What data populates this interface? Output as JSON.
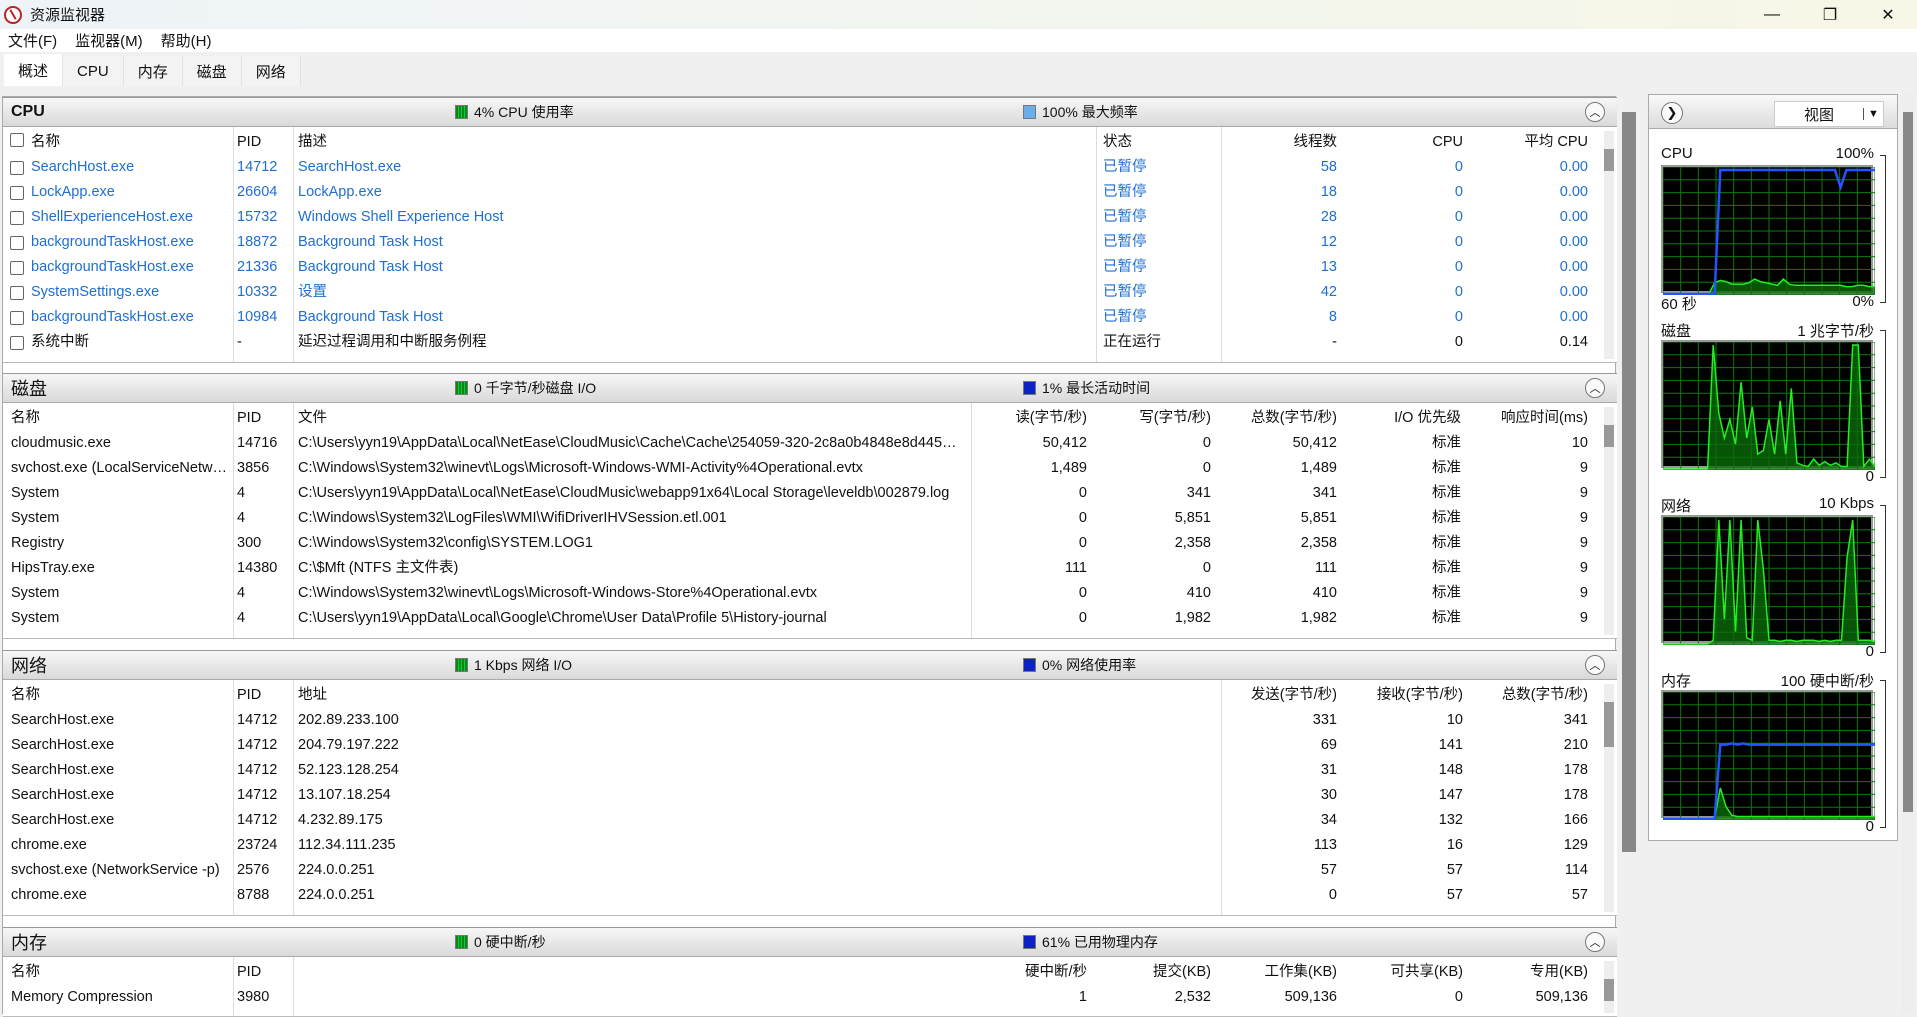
{
  "window": {
    "title": "资源监视器",
    "minimize": "—",
    "maximize": "❐",
    "close": "✕"
  },
  "menu": [
    "文件(F)",
    "监视器(M)",
    "帮助(H)"
  ],
  "tabs": [
    "概述",
    "CPU",
    "内存",
    "磁盘",
    "网络"
  ],
  "colors": {
    "link": "#1e6fd0",
    "graph_bg": "#000000",
    "graph_grid": "#0a7a0a",
    "graph_line": "#22ee22",
    "graph_max": "#2255ff"
  },
  "cpu": {
    "title": "CPU",
    "ind1": "4% CPU 使用率",
    "ind2": "100% 最大频率",
    "headers": [
      "名称",
      "PID",
      "描述",
      "状态",
      "线程数",
      "CPU",
      "平均 CPU"
    ],
    "rows": [
      [
        "SearchHost.exe",
        "14712",
        "SearchHost.exe",
        "已暂停",
        "58",
        "0",
        "0.00"
      ],
      [
        "LockApp.exe",
        "26604",
        "LockApp.exe",
        "已暂停",
        "18",
        "0",
        "0.00"
      ],
      [
        "ShellExperienceHost.exe",
        "15732",
        "Windows Shell Experience Host",
        "已暂停",
        "28",
        "0",
        "0.00"
      ],
      [
        "backgroundTaskHost.exe",
        "18872",
        "Background Task Host",
        "已暂停",
        "12",
        "0",
        "0.00"
      ],
      [
        "backgroundTaskHost.exe",
        "21336",
        "Background Task Host",
        "已暂停",
        "13",
        "0",
        "0.00"
      ],
      [
        "SystemSettings.exe",
        "10332",
        "设置",
        "已暂停",
        "42",
        "0",
        "0.00"
      ],
      [
        "backgroundTaskHost.exe",
        "10984",
        "Background Task Host",
        "已暂停",
        "8",
        "0",
        "0.00"
      ],
      [
        "系统中断",
        "-",
        "延迟过程调用和中断服务例程",
        "正在运行",
        "-",
        "0",
        "0.14"
      ]
    ]
  },
  "disk": {
    "title": "磁盘",
    "ind1": "0 千字节/秒磁盘 I/O",
    "ind2": "1% 最长活动时间",
    "headers": [
      "名称",
      "PID",
      "文件",
      "读(字节/秒)",
      "写(字节/秒)",
      "总数(字节/秒)",
      "I/O 优先级",
      "响应时间(ms)"
    ],
    "rows": [
      [
        "cloudmusic.exe",
        "14716",
        "C:\\Users\\yyn19\\AppData\\Local\\NetEase\\CloudMusic\\Cache\\Cache\\254059-320-2c8a0b4848e8d445401...",
        "50,412",
        "0",
        "50,412",
        "标准",
        "10"
      ],
      [
        "svchost.exe (LocalServiceNetwo...",
        "3856",
        "C:\\Windows\\System32\\winevt\\Logs\\Microsoft-Windows-WMI-Activity%4Operational.evtx",
        "1,489",
        "0",
        "1,489",
        "标准",
        "9"
      ],
      [
        "System",
        "4",
        "C:\\Users\\yyn19\\AppData\\Local\\NetEase\\CloudMusic\\webapp91x64\\Local Storage\\leveldb\\002879.log",
        "0",
        "341",
        "341",
        "标准",
        "9"
      ],
      [
        "System",
        "4",
        "C:\\Windows\\System32\\LogFiles\\WMI\\WifiDriverIHVSession.etl.001",
        "0",
        "5,851",
        "5,851",
        "标准",
        "9"
      ],
      [
        "Registry",
        "300",
        "C:\\Windows\\System32\\config\\SYSTEM.LOG1",
        "0",
        "2,358",
        "2,358",
        "标准",
        "9"
      ],
      [
        "HipsTray.exe",
        "14380",
        "C:\\$Mft (NTFS 主文件表)",
        "111",
        "0",
        "111",
        "标准",
        "9"
      ],
      [
        "System",
        "4",
        "C:\\Windows\\System32\\winevt\\Logs\\Microsoft-Windows-Store%4Operational.evtx",
        "0",
        "410",
        "410",
        "标准",
        "9"
      ],
      [
        "System",
        "4",
        "C:\\Users\\yyn19\\AppData\\Local\\Google\\Chrome\\User Data\\Profile 5\\History-journal",
        "0",
        "1,982",
        "1,982",
        "标准",
        "9"
      ]
    ]
  },
  "network": {
    "title": "网络",
    "ind1": "1 Kbps 网络 I/O",
    "ind2": "0% 网络使用率",
    "headers": [
      "名称",
      "PID",
      "地址",
      "发送(字节/秒)",
      "接收(字节/秒)",
      "总数(字节/秒)"
    ],
    "rows": [
      [
        "SearchHost.exe",
        "14712",
        "202.89.233.100",
        "331",
        "10",
        "341"
      ],
      [
        "SearchHost.exe",
        "14712",
        "204.79.197.222",
        "69",
        "141",
        "210"
      ],
      [
        "SearchHost.exe",
        "14712",
        "52.123.128.254",
        "31",
        "148",
        "178"
      ],
      [
        "SearchHost.exe",
        "14712",
        "13.107.18.254",
        "30",
        "147",
        "178"
      ],
      [
        "SearchHost.exe",
        "14712",
        "4.232.89.175",
        "34",
        "132",
        "166"
      ],
      [
        "chrome.exe",
        "23724",
        "112.34.111.235",
        "113",
        "16",
        "129"
      ],
      [
        "svchost.exe (NetworkService -p)",
        "2576",
        "224.0.0.251",
        "57",
        "57",
        "114"
      ],
      [
        "chrome.exe",
        "8788",
        "224.0.0.251",
        "0",
        "57",
        "57"
      ]
    ]
  },
  "memory": {
    "title": "内存",
    "ind1": "0 硬中断/秒",
    "ind2": "61% 已用物理内存",
    "headers": [
      "名称",
      "PID",
      "硬中断/秒",
      "提交(KB)",
      "工作集(KB)",
      "可共享(KB)",
      "专用(KB)"
    ],
    "rows": [
      [
        "Memory Compression",
        "3980",
        "1",
        "2,532",
        "509,136",
        "0",
        "509,136"
      ]
    ]
  },
  "sidepanel": {
    "view_label": "视图",
    "graphs": [
      {
        "name": "CPU",
        "max": "100%",
        "time": "60 秒",
        "min": "0%",
        "line": [
          0,
          0,
          0,
          0,
          0,
          0,
          0,
          0,
          0,
          9,
          11,
          10,
          8,
          8,
          8,
          9,
          12,
          10,
          9,
          8,
          7,
          12,
          8,
          7,
          7,
          7,
          7,
          7,
          7,
          7,
          7,
          7,
          6,
          6,
          7,
          7,
          6,
          6
        ],
        "max_line": [
          0,
          0,
          0,
          0,
          0,
          0,
          0,
          0,
          0,
          0,
          100,
          100,
          100,
          100,
          100,
          100,
          100,
          100,
          100,
          100,
          100,
          100,
          100,
          100,
          100,
          100,
          100,
          100,
          100,
          100,
          100,
          86,
          100,
          100,
          100,
          100,
          100,
          100
        ]
      },
      {
        "name": "磁盘",
        "max": "1 兆字节/秒",
        "min": "0",
        "line": [
          0,
          0,
          0,
          0,
          0,
          0,
          0,
          0,
          0,
          100,
          45,
          25,
          40,
          20,
          70,
          25,
          50,
          12,
          15,
          40,
          12,
          55,
          12,
          65,
          5,
          3,
          2,
          8,
          3,
          6,
          3,
          5,
          2,
          2,
          100,
          100,
          2,
          8,
          2
        ]
      },
      {
        "name": "网络",
        "max": "10 Kbps",
        "min": "0",
        "line": [
          0,
          0,
          0,
          0,
          0,
          0,
          0,
          0,
          0,
          3,
          100,
          20,
          100,
          10,
          100,
          5,
          3,
          100,
          60,
          3,
          3,
          2,
          3,
          3,
          2,
          3,
          3,
          3,
          2,
          3,
          2,
          3,
          3,
          70,
          100,
          3,
          3,
          3,
          2
        ]
      },
      {
        "name": "内存",
        "max": "100 硬中断/秒",
        "min": "0",
        "line": [
          0,
          0,
          0,
          0,
          0,
          0,
          0,
          0,
          0,
          0,
          25,
          10,
          3,
          2,
          2,
          2,
          2,
          2,
          2,
          2,
          2,
          2,
          2,
          2,
          2,
          2,
          2,
          2,
          2,
          2,
          2,
          2,
          2,
          2,
          2,
          2,
          2,
          2
        ],
        "max_line": [
          0,
          0,
          0,
          0,
          0,
          0,
          0,
          0,
          0,
          0,
          60,
          60,
          61,
          60,
          61,
          60,
          60,
          60,
          60,
          60,
          60,
          60,
          60,
          60,
          60,
          60,
          60,
          60,
          60,
          60,
          60,
          60,
          60,
          60,
          60,
          60,
          60,
          60
        ]
      }
    ]
  }
}
